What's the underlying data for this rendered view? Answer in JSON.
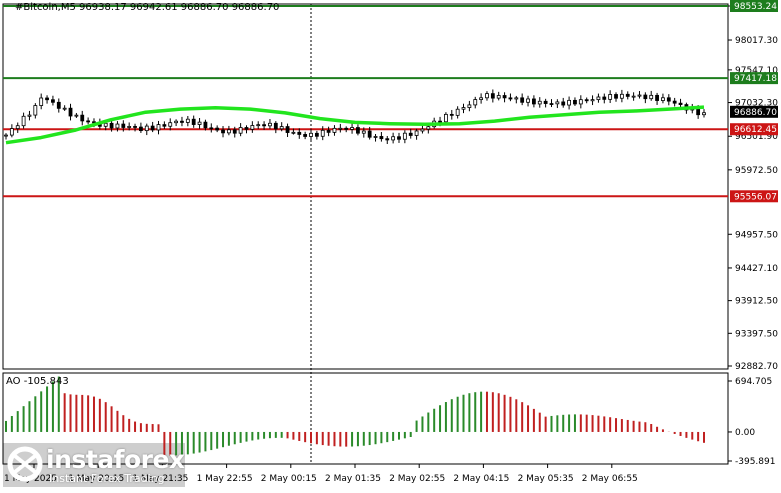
{
  "header": {
    "symbol_line": "#Bitcoin,M5  96938.17 96942.61 96886.70 96886.70",
    "ao_label": "AO -105.843"
  },
  "watermark": {
    "brand": "instaforex",
    "tagline": "Instant Forex Trading"
  },
  "colors": {
    "candle": "#000000",
    "ma_green": "#22e51e",
    "level_green": "#1d7d1d",
    "level_red": "#cc1515",
    "ao_up": "#2a8a2a",
    "ao_down": "#c02020"
  },
  "chart_data": [
    {
      "type": "candlestick",
      "title": "#Bitcoin,M5",
      "ohlc_last": {
        "open": 96938.17,
        "high": 96942.61,
        "low": 96886.7,
        "close": 96886.7
      },
      "current_price_label": "96886.70",
      "ylim": [
        92882.7,
        98553.24
      ],
      "y_ticks": [
        "98553.24",
        "98017.30",
        "97547.10",
        "97032.30",
        "96501.90",
        "95972.50",
        "94957.50",
        "94427.10",
        "93912.50",
        "93397.50",
        "92882.70"
      ],
      "x_ticks": [
        "1 May 2025",
        "1 May 20:15",
        "1 May 21:35",
        "1 May 22:55",
        "2 May 00:15",
        "2 May 01:35",
        "2 May 02:55",
        "2 May 04:15",
        "2 May 05:35",
        "2 May 06:55"
      ],
      "horizontal_levels": [
        {
          "value": 98553.24,
          "label": "98553.24",
          "color": "green"
        },
        {
          "value": 97417.18,
          "label": "97417.18",
          "color": "green"
        },
        {
          "value": 96612.45,
          "label": "96612.45",
          "color": "red"
        },
        {
          "value": 95556.07,
          "label": "95556.07",
          "color": "red"
        }
      ],
      "moving_average": [
        96400,
        96480,
        96600,
        96760,
        96880,
        96930,
        96950,
        96930,
        96870,
        96780,
        96720,
        96700,
        96690,
        96700,
        96740,
        96800,
        96840,
        96880,
        96900,
        96930,
        96960
      ]
    },
    {
      "type": "bar",
      "title": "AO -105.843",
      "ylim": [
        -395.891,
        694.705
      ],
      "y_ticks": [
        "694.705",
        "0.00",
        "-395.891"
      ]
    }
  ]
}
